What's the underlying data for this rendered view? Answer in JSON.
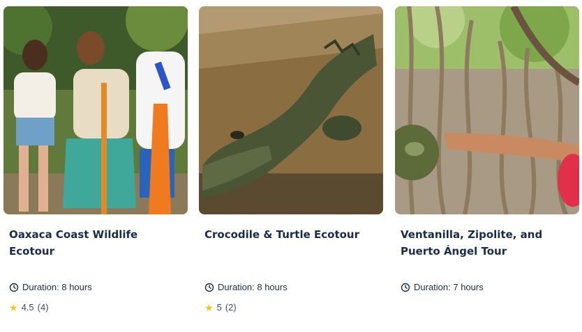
{
  "cards": [
    {
      "title": "Oaxaca Coast Wildlife Ecotour",
      "duration": "Duration: 8 hours",
      "rating": "4.5",
      "reviews": "(4)"
    },
    {
      "title": "Crocodile & Turtle Ecotour",
      "duration": "Duration: 8 hours",
      "rating": "5",
      "reviews": "(2)"
    },
    {
      "title": "Ventanilla, Zipolite, and Puerto Ángel Tour",
      "duration": "Duration: 7 hours"
    }
  ],
  "icons": {
    "duration": "clock-icon",
    "rating": "star-icon"
  },
  "colors": {
    "text": "#1a2b49",
    "star": "#f5c518"
  }
}
